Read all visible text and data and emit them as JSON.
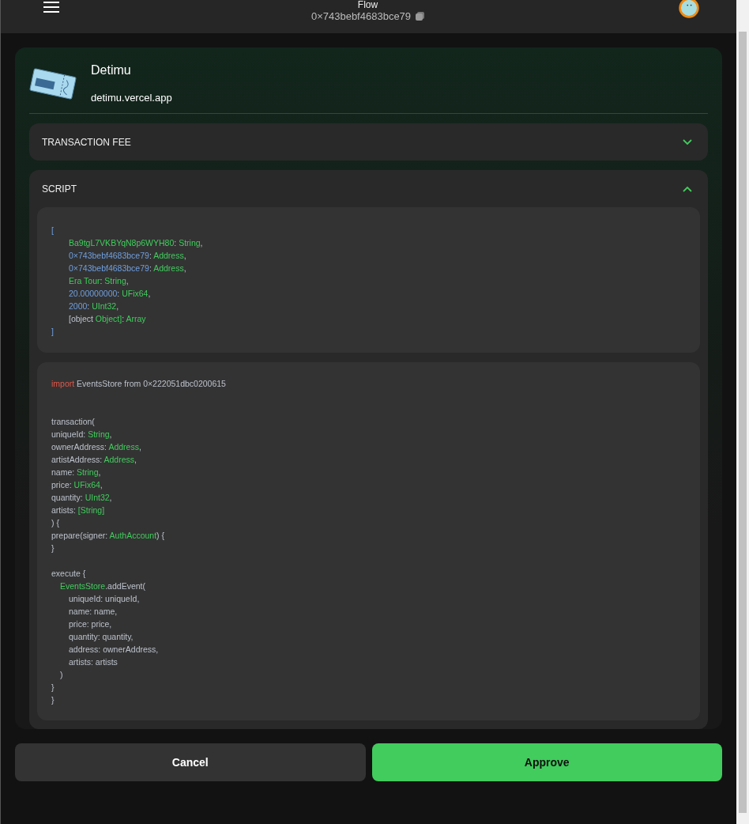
{
  "header": {
    "title": "Flow",
    "address": "0×743bebf4683bce79"
  },
  "dapp": {
    "name": "Detimu",
    "url": "detimu.vercel.app"
  },
  "sections": [
    {
      "title": "TRANSACTION FEE",
      "expanded": false
    },
    {
      "title": "SCRIPT",
      "expanded": true
    }
  ],
  "arguments": [
    {
      "kind": "outer",
      "parts": [
        {
          "kind": "value",
          "text": "["
        }
      ]
    },
    {
      "kind": "inner",
      "parts": [
        {
          "kind": "string",
          "text": "Ba9tgL7VKBYqN8p6WYH80"
        },
        {
          "kind": "plain",
          "text": ": "
        },
        {
          "kind": "string",
          "text": "String"
        },
        {
          "kind": "plain",
          "text": ","
        }
      ]
    },
    {
      "kind": "inner",
      "parts": [
        {
          "kind": "value",
          "text": "0×743bebf4683bce79"
        },
        {
          "kind": "plain",
          "text": ": "
        },
        {
          "kind": "string",
          "text": "Address"
        },
        {
          "kind": "plain",
          "text": ","
        }
      ]
    },
    {
      "kind": "inner",
      "parts": [
        {
          "kind": "value",
          "text": "0×743bebf4683bce79"
        },
        {
          "kind": "plain",
          "text": ": "
        },
        {
          "kind": "string",
          "text": "Address"
        },
        {
          "kind": "plain",
          "text": ","
        }
      ]
    },
    {
      "kind": "inner",
      "parts": [
        {
          "kind": "string",
          "text": "Era Tour"
        },
        {
          "kind": "plain",
          "text": ": "
        },
        {
          "kind": "string",
          "text": "String"
        },
        {
          "kind": "plain",
          "text": ","
        }
      ]
    },
    {
      "kind": "inner",
      "parts": [
        {
          "kind": "value",
          "text": "20.00000000"
        },
        {
          "kind": "plain",
          "text": ": "
        },
        {
          "kind": "string",
          "text": "UFix64"
        },
        {
          "kind": "plain",
          "text": ","
        }
      ]
    },
    {
      "kind": "inner",
      "parts": [
        {
          "kind": "value",
          "text": "2000"
        },
        {
          "kind": "plain",
          "text": ": "
        },
        {
          "kind": "string",
          "text": "UInt32"
        },
        {
          "kind": "plain",
          "text": ","
        }
      ]
    },
    {
      "kind": "inner",
      "parts": [
        {
          "kind": "plain",
          "text": "[object "
        },
        {
          "kind": "string",
          "text": "Object]"
        },
        {
          "kind": "plain",
          "text": ": "
        },
        {
          "kind": "string",
          "text": "Array"
        }
      ]
    },
    {
      "kind": "outer",
      "parts": [
        {
          "kind": "value",
          "text": "]"
        }
      ]
    }
  ],
  "code": [
    {
      "kind": "outer",
      "parts": [
        {
          "kind": "keyword",
          "text": "import"
        },
        {
          "kind": "plain",
          "text": " EventsStore from 0×222051dbc0200615"
        }
      ]
    },
    {
      "kind": "blank"
    },
    {
      "kind": "blank"
    },
    {
      "kind": "outer",
      "parts": [
        {
          "kind": "plain",
          "text": "transaction("
        }
      ]
    },
    {
      "kind": "outer",
      "parts": [
        {
          "kind": "plain",
          "text": "uniqueId: "
        },
        {
          "kind": "string",
          "text": "String"
        },
        {
          "kind": "plain",
          "text": ","
        }
      ]
    },
    {
      "kind": "outer",
      "parts": [
        {
          "kind": "plain",
          "text": "ownerAddress: "
        },
        {
          "kind": "string",
          "text": "Address"
        },
        {
          "kind": "plain",
          "text": ","
        }
      ]
    },
    {
      "kind": "outer",
      "parts": [
        {
          "kind": "plain",
          "text": "artistAddress: "
        },
        {
          "kind": "string",
          "text": "Address"
        },
        {
          "kind": "plain",
          "text": ","
        }
      ]
    },
    {
      "kind": "outer",
      "parts": [
        {
          "kind": "plain",
          "text": "name: "
        },
        {
          "kind": "string",
          "text": "String"
        },
        {
          "kind": "plain",
          "text": ","
        }
      ]
    },
    {
      "kind": "outer",
      "parts": [
        {
          "kind": "plain",
          "text": "price: "
        },
        {
          "kind": "string",
          "text": "UFix64"
        },
        {
          "kind": "plain",
          "text": ","
        }
      ]
    },
    {
      "kind": "outer",
      "parts": [
        {
          "kind": "plain",
          "text": "quantity: "
        },
        {
          "kind": "string",
          "text": "UInt32"
        },
        {
          "kind": "plain",
          "text": ","
        }
      ]
    },
    {
      "kind": "outer",
      "parts": [
        {
          "kind": "plain",
          "text": "artists: "
        },
        {
          "kind": "string",
          "text": "[String]"
        }
      ]
    },
    {
      "kind": "outer",
      "parts": [
        {
          "kind": "plain",
          "text": ") {"
        }
      ]
    },
    {
      "kind": "outer",
      "parts": [
        {
          "kind": "plain",
          "text": "prepare(signer: "
        },
        {
          "kind": "string",
          "text": "AuthAccount"
        },
        {
          "kind": "plain",
          "text": ") {"
        }
      ]
    },
    {
      "kind": "outer",
      "parts": [
        {
          "kind": "plain",
          "text": "}"
        }
      ]
    },
    {
      "kind": "blank"
    },
    {
      "kind": "outer",
      "parts": [
        {
          "kind": "plain",
          "text": "execute {"
        }
      ]
    },
    {
      "kind": "middle",
      "parts": [
        {
          "kind": "string",
          "text": "EventsStore"
        },
        {
          "kind": "plain",
          "text": ".addEvent("
        }
      ]
    },
    {
      "kind": "inner",
      "parts": [
        {
          "kind": "plain",
          "text": "uniqueId: uniqueId,"
        }
      ]
    },
    {
      "kind": "inner",
      "parts": [
        {
          "kind": "plain",
          "text": "name: name,"
        }
      ]
    },
    {
      "kind": "inner",
      "parts": [
        {
          "kind": "plain",
          "text": "price: price,"
        }
      ]
    },
    {
      "kind": "inner",
      "parts": [
        {
          "kind": "plain",
          "text": "quantity: quantity,"
        }
      ]
    },
    {
      "kind": "inner",
      "parts": [
        {
          "kind": "plain",
          "text": "address: ownerAddress,"
        }
      ]
    },
    {
      "kind": "inner",
      "parts": [
        {
          "kind": "plain",
          "text": "artists: artists"
        }
      ]
    },
    {
      "kind": "middle",
      "parts": [
        {
          "kind": "plain",
          "text": ")"
        }
      ]
    },
    {
      "kind": "outer",
      "parts": [
        {
          "kind": "plain",
          "text": "}"
        }
      ]
    },
    {
      "kind": "outer",
      "parts": [
        {
          "kind": "plain",
          "text": "}"
        }
      ]
    }
  ],
  "buttons": [
    {
      "label": "Cancel",
      "kind": "secondary"
    },
    {
      "label": "Approve",
      "kind": "primary"
    }
  ]
}
